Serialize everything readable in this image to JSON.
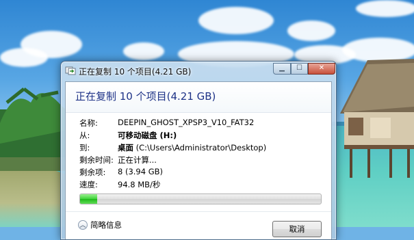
{
  "window": {
    "title": "正在复制 10 个项目(4.21 GB)",
    "heading": "正在复制 10 个项目(4.21 GB)",
    "controls": {
      "minimize": "▁",
      "maximize": "☐",
      "close": "✕"
    }
  },
  "details": [
    {
      "label": "名称:",
      "value": "DEEPIN_GHOST_XPSP3_V10_FAT32",
      "bold": false,
      "extra": ""
    },
    {
      "label": "从:",
      "value": "可移动磁盘 (H:)",
      "bold": true,
      "extra": ""
    },
    {
      "label": "到:",
      "value": "桌面",
      "bold": true,
      "extra": " (C:\\Users\\Administrator\\Desktop)"
    },
    {
      "label": "剩余时间:",
      "value": "正在计算...",
      "bold": false,
      "extra": ""
    },
    {
      "label": "剩余项:",
      "value": "8 (3.94 GB)",
      "bold": false,
      "extra": ""
    },
    {
      "label": "速度:",
      "value": "94.8 MB/秒",
      "bold": false,
      "extra": ""
    }
  ],
  "progress": {
    "fraction": 0.07,
    "color": "#2fc52a"
  },
  "footer": {
    "more_info": "简略信息",
    "more_info_icon": "chevron-up-icon",
    "cancel": "取消"
  },
  "colors": {
    "heading": "#1e3287",
    "close_button": "#c7503b"
  }
}
